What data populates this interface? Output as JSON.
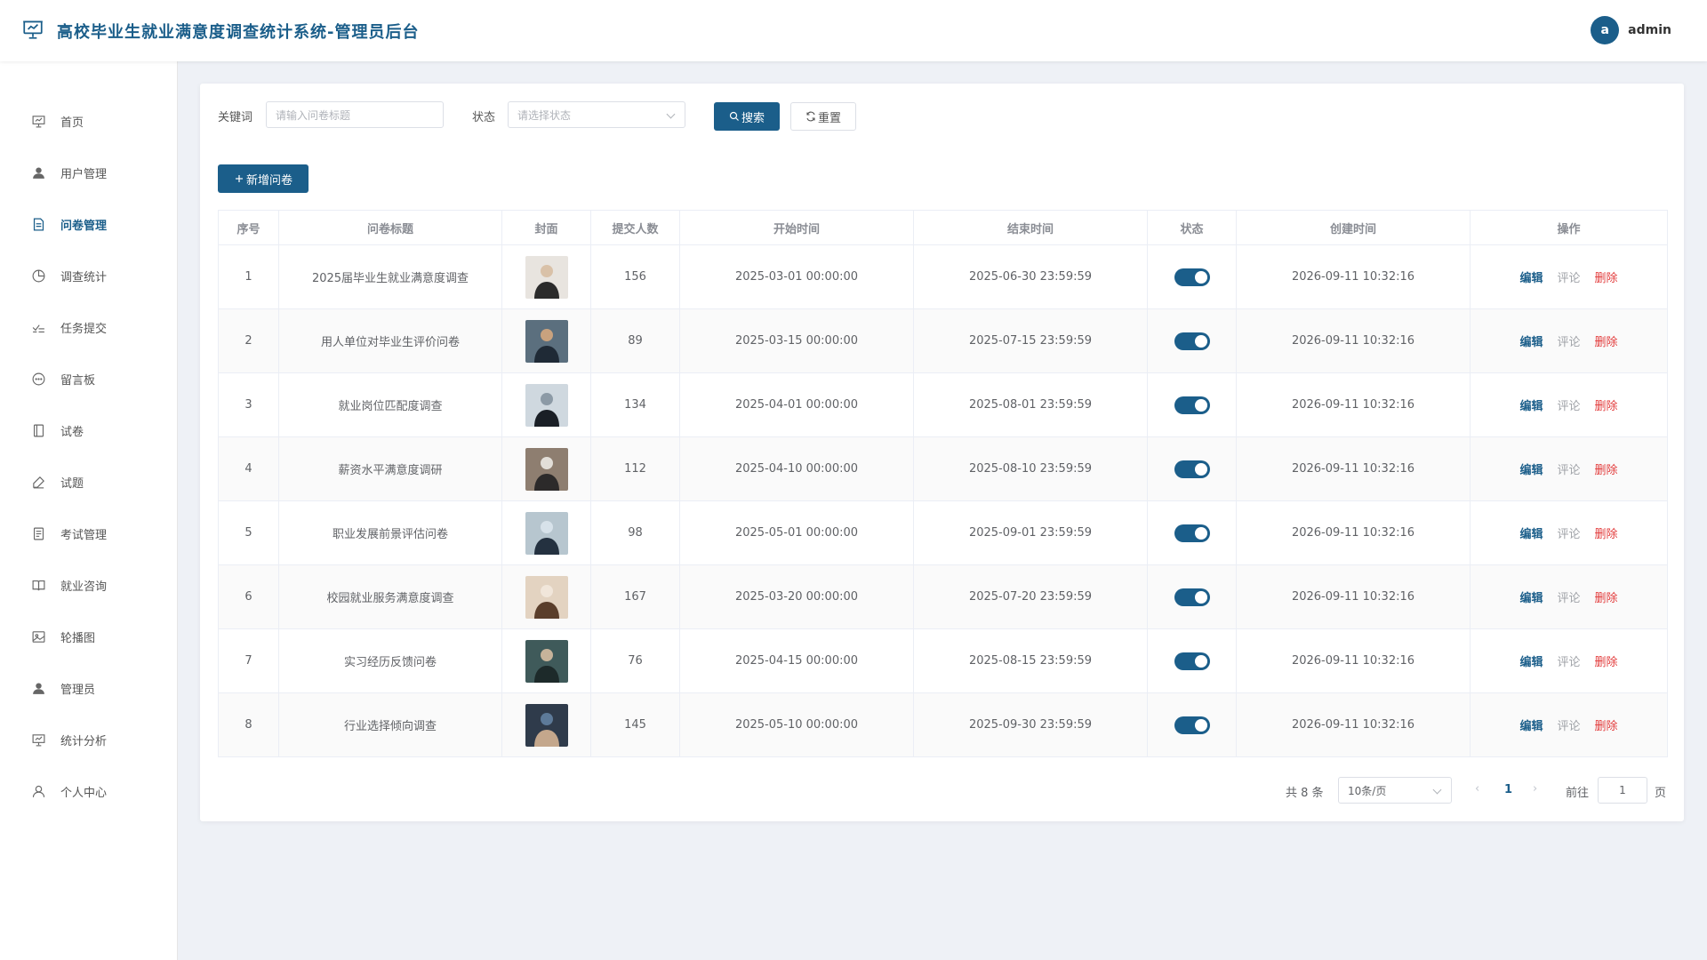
{
  "app": {
    "title": "高校毕业生就业满意度调查统计系统-管理员后台",
    "user": {
      "avatar_letter": "a",
      "name": "admin"
    }
  },
  "colors": {
    "primary": "#1b5e8a",
    "danger": "#e23a3a",
    "background": "#eef1f6"
  },
  "sidebar": {
    "items": [
      {
        "label": "首页",
        "icon": "dashboard-icon"
      },
      {
        "label": "用户管理",
        "icon": "user-icon"
      },
      {
        "label": "问卷管理",
        "icon": "document-icon",
        "active": true
      },
      {
        "label": "调查统计",
        "icon": "pie-chart-icon"
      },
      {
        "label": "任务提交",
        "icon": "task-check-icon"
      },
      {
        "label": "留言板",
        "icon": "chat-bubble-icon"
      },
      {
        "label": "试卷",
        "icon": "notebook-icon"
      },
      {
        "label": "试题",
        "icon": "edit-pen-icon"
      },
      {
        "label": "考试管理",
        "icon": "list-document-icon"
      },
      {
        "label": "就业咨询",
        "icon": "book-open-icon"
      },
      {
        "label": "轮播图",
        "icon": "picture-icon"
      },
      {
        "label": "管理员",
        "icon": "admin-user-icon"
      },
      {
        "label": "统计分析",
        "icon": "presentation-chart-icon"
      },
      {
        "label": "个人中心",
        "icon": "user-outline-icon"
      }
    ]
  },
  "search": {
    "keyword_label": "关键词",
    "keyword_placeholder": "请输入问卷标题",
    "status_label": "状态",
    "status_placeholder": "请选择状态",
    "search_button": "搜索",
    "reset_button": "重置"
  },
  "toolbar": {
    "add_button": "新增问卷"
  },
  "table": {
    "columns": [
      "序号",
      "问卷标题",
      "封面",
      "提交人数",
      "开始时间",
      "结束时间",
      "状态",
      "创建时间",
      "操作"
    ],
    "actions": {
      "edit": "编辑",
      "comment": "评论",
      "delete": "删除"
    },
    "rows": [
      {
        "index": "1",
        "title": "2025届毕业生就业满意度调查",
        "submissions": "156",
        "start": "2025-03-01 00:00:00",
        "end": "2025-06-30 23:59:59",
        "status_on": true,
        "created": "2026-09-11 10:32:16"
      },
      {
        "index": "2",
        "title": "用人单位对毕业生评价问卷",
        "submissions": "89",
        "start": "2025-03-15 00:00:00",
        "end": "2025-07-15 23:59:59",
        "status_on": true,
        "created": "2026-09-11 10:32:16"
      },
      {
        "index": "3",
        "title": "就业岗位匹配度调查",
        "submissions": "134",
        "start": "2025-04-01 00:00:00",
        "end": "2025-08-01 23:59:59",
        "status_on": true,
        "created": "2026-09-11 10:32:16"
      },
      {
        "index": "4",
        "title": "薪资水平满意度调研",
        "submissions": "112",
        "start": "2025-04-10 00:00:00",
        "end": "2025-08-10 23:59:59",
        "status_on": true,
        "created": "2026-09-11 10:32:16"
      },
      {
        "index": "5",
        "title": "职业发展前景评估问卷",
        "submissions": "98",
        "start": "2025-05-01 00:00:00",
        "end": "2025-09-01 23:59:59",
        "status_on": true,
        "created": "2026-09-11 10:32:16"
      },
      {
        "index": "6",
        "title": "校园就业服务满意度调查",
        "submissions": "167",
        "start": "2025-03-20 00:00:00",
        "end": "2025-07-20 23:59:59",
        "status_on": true,
        "created": "2026-09-11 10:32:16"
      },
      {
        "index": "7",
        "title": "实习经历反馈问卷",
        "submissions": "76",
        "start": "2025-04-15 00:00:00",
        "end": "2025-08-15 23:59:59",
        "status_on": true,
        "created": "2026-09-11 10:32:16"
      },
      {
        "index": "8",
        "title": "行业选择倾向调查",
        "submissions": "145",
        "start": "2025-05-10 00:00:00",
        "end": "2025-09-30 23:59:59",
        "status_on": true,
        "created": "2026-09-11 10:32:16"
      }
    ]
  },
  "pagination": {
    "total": "共 8 条",
    "page_size": "10条/页",
    "current": "1",
    "goto_label": "前往",
    "goto_value": "1",
    "page_suffix": "页"
  }
}
